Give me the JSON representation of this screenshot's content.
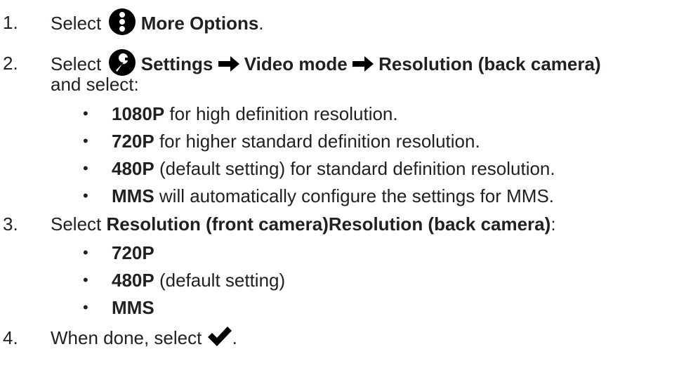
{
  "steps": [
    {
      "number": "1.",
      "select_word": "Select",
      "icon": "more-options-icon",
      "label": "More Options",
      "period": "."
    },
    {
      "number": "2.",
      "select_word": "Select",
      "icon": "settings-wrench-icon",
      "path": [
        "Settings",
        "Video mode",
        "Resolution"
      ],
      "path_suffix": "(back camera)",
      "continuation": "and select:",
      "bullets": [
        {
          "bold": "1080P",
          "rest": " for high definition resolution."
        },
        {
          "bold": "720P",
          "rest": " for higher standard definition resolution."
        },
        {
          "bold": "480P",
          "rest": " (default setting) for standard definition resolution."
        },
        {
          "bold": "MMS",
          "rest": " will automatically configure the settings for MMS."
        }
      ]
    },
    {
      "number": "3.",
      "select_word": "Select",
      "label": "Resolution (front camera)Resolution (back camera)",
      "colon": ":",
      "bullets": [
        {
          "bold": "720P",
          "rest": ""
        },
        {
          "bold": "480P",
          "rest": " (default setting)"
        },
        {
          "bold": "MMS",
          "rest": ""
        }
      ]
    },
    {
      "number": "4.",
      "text": "When done, select",
      "icon": "checkmark-icon",
      "period": "."
    }
  ],
  "bullet_char": "•",
  "arrow_icon": "right-arrow-icon"
}
